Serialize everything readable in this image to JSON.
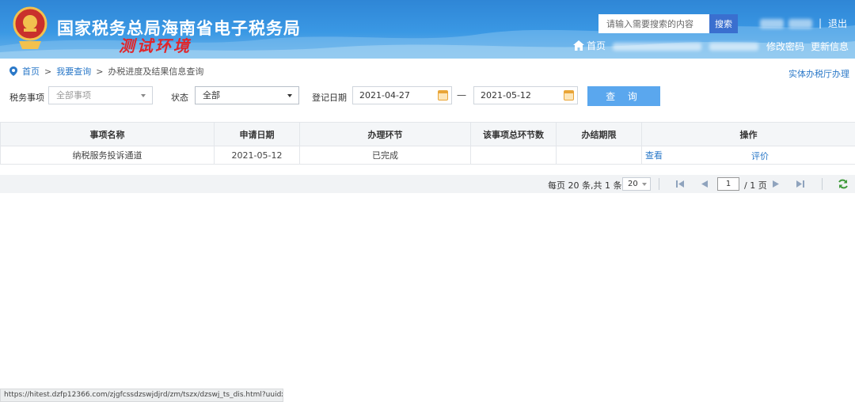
{
  "header": {
    "site_title": "国家税务总局海南省电子税务局",
    "test_env": "测试环境",
    "search_placeholder": "请输入需要搜索的内容",
    "search_button": "搜索",
    "separator": "|",
    "logout": "退出",
    "home": "首页",
    "change_password": "修改密码",
    "update_info": "更新信息"
  },
  "breadcrumb": {
    "home": "首页",
    "sep1": ">",
    "query": "我要查询",
    "sep2": ">",
    "current": "办税进度及结果信息查询"
  },
  "side_link": "实体办税厅办理",
  "filters": {
    "tax_item_label": "税务事项",
    "tax_item_value": "全部事项",
    "status_label": "状态",
    "status_value": "全部",
    "reg_date_label": "登记日期",
    "date_from": "2021-04-27",
    "date_sep": "一",
    "date_to": "2021-05-12",
    "query_button": "查 询"
  },
  "table": {
    "headers": [
      "事项名称",
      "申请日期",
      "办理环节",
      "该事项总环节数",
      "办结期限",
      "操作"
    ],
    "rows": [
      {
        "name": "纳税服务投诉通道",
        "apply_date": "2021-05-12",
        "stage": "已完成",
        "total_steps": "",
        "deadline": "",
        "action_view": "查看",
        "action_eval": "评价"
      }
    ]
  },
  "pager": {
    "info": "每页 20 条,共 1 条",
    "page_size": "20",
    "current_page": "1",
    "total_pages": "/ 1 页"
  },
  "status_bar": "https://hitest.dzfp12366.com/zjgfcssdzswjdjrd/zm/tszx/dzswj_ts_dis.html?uuidxh=72..."
}
